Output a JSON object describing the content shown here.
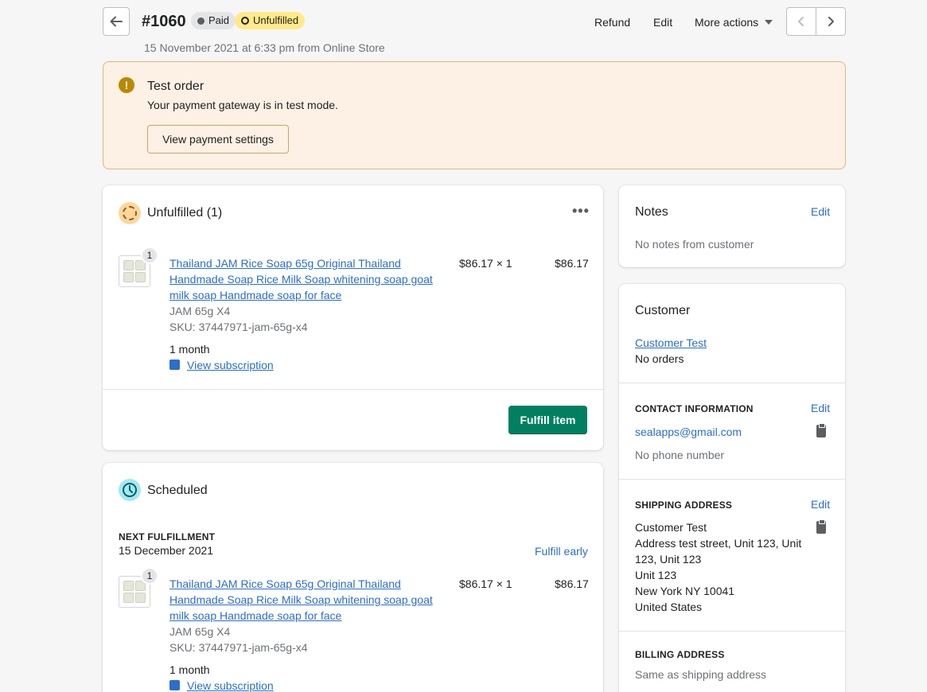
{
  "header": {
    "order_number": "#1060",
    "paid_badge": "Paid",
    "fulfillment_badge": "Unfulfilled",
    "subtitle": "15 November 2021 at 6:33 pm from Online Store",
    "refund_label": "Refund",
    "edit_label": "Edit",
    "more_actions_label": "More actions"
  },
  "banner": {
    "title": "Test order",
    "message": "Your payment gateway is in test mode.",
    "button_label": "View payment settings"
  },
  "unfulfilled": {
    "title": "Unfulfilled (1)",
    "item": {
      "quantity_badge": "1",
      "title_line1": "Thailand JAM Rice Soap 65g Original Thailand",
      "title_line2": "Handmade Soap Rice Milk Soap whitening soap goat",
      "title_line3": "milk soap Handmade soap for face",
      "variant": "JAM 65g X4",
      "sku": "SKU: 37447971-jam-65g-x4",
      "price_qty": "$86.17 × 1",
      "total": "$86.17",
      "plan": "1 month",
      "subscription_link": "View subscription"
    },
    "fulfill_button": "Fulfill item"
  },
  "scheduled": {
    "title": "Scheduled",
    "next_label": "NEXT FULFILLMENT",
    "next_date": "15 December 2021",
    "fulfill_early": "Fulfill early",
    "item": {
      "quantity_badge": "1",
      "title_line1": "Thailand JAM Rice Soap 65g Original Thailand",
      "title_line2": "Handmade Soap Rice Milk Soap whitening soap goat",
      "title_line3": "milk soap Handmade soap for face",
      "variant": "JAM 65g X4",
      "sku": "SKU: 37447971-jam-65g-x4",
      "price_qty": "$86.17 × 1",
      "total": "$86.17",
      "plan": "1 month",
      "subscription_link": "View subscription"
    }
  },
  "notes": {
    "title": "Notes",
    "edit_label": "Edit",
    "text": "No notes from customer"
  },
  "customer": {
    "title": "Customer",
    "name_link": "Customer Test",
    "orders": "No orders",
    "contact_heading": "CONTACT INFORMATION",
    "contact_edit": "Edit",
    "email": "sealapps@gmail.com",
    "phone": "No phone number",
    "shipping_heading": "SHIPPING ADDRESS",
    "shipping_edit": "Edit",
    "shipping_lines": [
      "Customer Test",
      "Address test street, Unit 123, Unit",
      "123, Unit 123",
      "Unit 123",
      "New York NY 10041",
      "United States"
    ],
    "billing_heading": "BILLING ADDRESS",
    "billing_text": "Same as shipping address"
  },
  "colors": {
    "accent_green": "#008060",
    "link_blue": "#2c6ecb",
    "banner_bg": "#fcf1e4",
    "badge_yellow": "#ffea8a"
  }
}
